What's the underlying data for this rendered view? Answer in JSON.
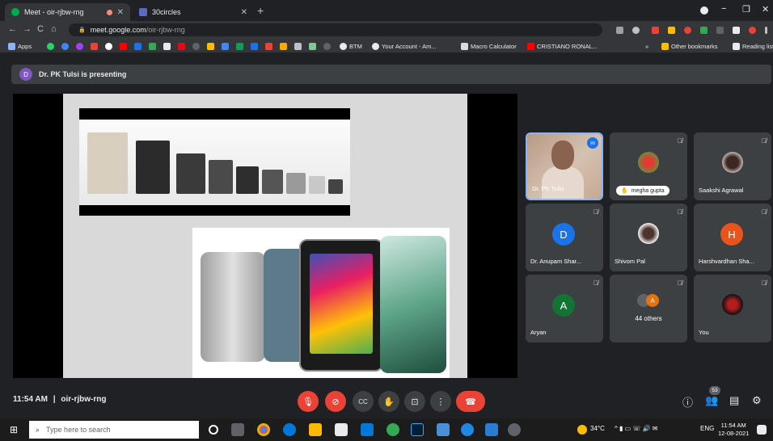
{
  "browser": {
    "tabs": [
      {
        "title": "Meet - oir-rjbw-rng",
        "active": true
      },
      {
        "title": "30circles",
        "active": false
      }
    ],
    "new_tab": "+",
    "window_controls": {
      "minimize": "−",
      "restore": "❐",
      "close": "✕"
    },
    "nav": {
      "back": "←",
      "forward": "→",
      "reload": "C",
      "home": "⌂"
    },
    "url_host": "meet.google.com",
    "url_path": "/oir-rjbw-rng",
    "bookmarks": {
      "apps": "Apps",
      "btm": "BTM",
      "your_account": "Your Account - Am...",
      "macro": "Macro Calculator",
      "cristiano": "CRISTIANO RONAL...",
      "more": "»",
      "other": "Other bookmarks",
      "reading": "Reading list"
    }
  },
  "meeting": {
    "presenter_initial": "D",
    "presenting_text": "Dr. PK Tulsi is presenting",
    "time": "11:54 AM",
    "separator": "|",
    "code": "oir-rjbw-rng",
    "participant_count": "53"
  },
  "participants": [
    {
      "name": "Dr. PK Tulsi",
      "type": "video",
      "speaking": true
    },
    {
      "name": "megha gupta",
      "type": "photo",
      "hand_raised": true
    },
    {
      "name": "Saakshi Agrawal",
      "type": "photo"
    },
    {
      "name": "Dr. Anupam Shar...",
      "type": "initial",
      "initial": "D",
      "color": "#1a73e8"
    },
    {
      "name": "Shivom Pal",
      "type": "photo"
    },
    {
      "name": "Harshvardhan Sha...",
      "type": "initial",
      "initial": "H",
      "color": "#e8541c"
    },
    {
      "name": "Aryan",
      "type": "initial",
      "initial": "A",
      "color": "#137333"
    },
    {
      "name": "44 others",
      "type": "others",
      "initial": "A"
    },
    {
      "name": "You",
      "type": "photo"
    }
  ],
  "controls": {
    "mic_off": "🎙",
    "cam_off": "⊘",
    "captions": "CC",
    "raise_hand": "✋",
    "present": "⊡",
    "more": "⋮",
    "end_call": "☎",
    "details": "ⓘ",
    "people": "👥",
    "chat": "▤",
    "activities": "⚙"
  },
  "taskbar": {
    "start": "⊞",
    "search_placeholder": "Type here to search",
    "temperature": "34°C",
    "tray": "^ ▮ ▭ ☏ 🔊 ✉",
    "language": "ENG",
    "time": "11:54 AM",
    "date": "12-08-2021"
  },
  "colors": {
    "accent": "#8ab4f8",
    "danger": "#ea4335",
    "meet_bg": "#202124"
  }
}
